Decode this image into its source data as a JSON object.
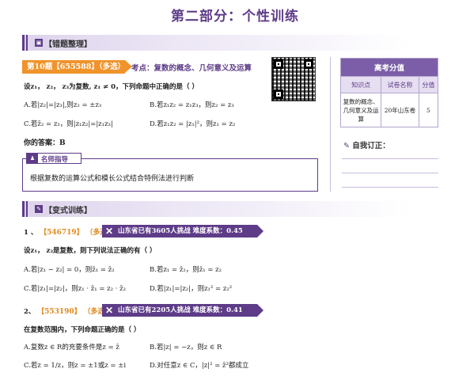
{
  "page_title": "第二部分：个性训练",
  "section1": {
    "icon": "list-icon",
    "label": "【错题整理】"
  },
  "question10": {
    "badge": "第10题【655588】（多选）",
    "topic": "考点：复数的概念、几何意义及运算",
    "stem": "设z₁， z₂， z₃为复数, z₁ ≠ 0，下列命题中正确的是（   ）",
    "options": {
      "a": "A.若|z₂|=|z₃|,则z₂ = ±z₃",
      "b": "B.若z₁z₂ = z₁z₃，则z₂ = z₃",
      "c": "C.若z̄₂ = z₃，则|z₁z₂|=|z₁z₃|",
      "d": "D.若z₁z₂ = |z₁|²，则z₁ = z₂"
    },
    "answer": "你的答案：B"
  },
  "qr_code": {
    "icon": "qr-code-icon"
  },
  "score_table": {
    "header": "高考分值",
    "columns": [
      "知识点",
      "试卷名称",
      "分值"
    ],
    "row": {
      "knowledge": "复数的概念、几何意义及运算",
      "paper": "20年山东卷",
      "score": "5"
    }
  },
  "self_correct": {
    "icon": "pin-icon",
    "label": "自我订正："
  },
  "teacher": {
    "icon": "teacher-icon",
    "label": "名师指导",
    "text": "根据复数的运算公式和模长公式结合特例法进行判断"
  },
  "section2": {
    "icon": "pencil-icon",
    "label": "【变式训练】"
  },
  "practice1": {
    "number": "1 、",
    "id": "【546719】",
    "type": "（多选）",
    "banner": "山东省已有3605人挑战  难度系数：0.45",
    "stem": "设z₁， z₂是复数，则下列说法正确的有（   ）",
    "options": {
      "a": "A.若|z₁ − z₂| = 0，则z̄₁ = z̄₂",
      "b": "B.若z₁ = z̄₂，则z̄₁ = z₂",
      "c": "C.若|z₁|=|z₂|，则z₁ · z̄₁ = z₂ · z̄₂",
      "d": "D.若|z₁|=|z₂|，则z₁² = z₂²"
    }
  },
  "practice2": {
    "number": "2、",
    "id": "【553190】",
    "type": "（多选）",
    "banner": "山东省已有2205人挑战  难度系数：0.41",
    "stem": "在复数范围内，下列命题正确的是（   ）",
    "options": {
      "a": "A.复数z ∈ R的充要条件是z = z̄",
      "b": "B.若|z| = −z，则z ∈ R",
      "c": "C.若z = 1/z，则z = ±1或z = ±i",
      "d": "D.对任意z ∈ C，|z|² = z̄²都成立"
    }
  },
  "colors": {
    "accent": "#5e3c88",
    "badge_orange": "#f0932b",
    "id_orange": "#e08a1e"
  }
}
